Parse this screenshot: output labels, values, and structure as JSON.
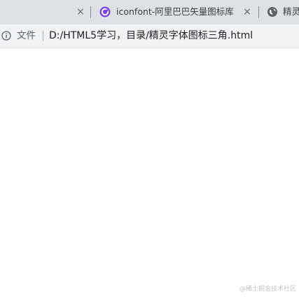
{
  "tabs": [
    {
      "title": "",
      "active": false,
      "close": "×"
    },
    {
      "title": "iconfont-阿里巴巴矢量图标库",
      "active": false,
      "icon": "iconfont-logo-icon",
      "close": "×"
    },
    {
      "title": "精灵",
      "active": false,
      "icon": "globe-icon"
    }
  ],
  "address_bar": {
    "info_icon": "info-icon",
    "file_label": "文件",
    "url": "D:/HTML5学习，目录/精灵字体图标三角.html"
  },
  "watermark": "@稀土掘金技术社区",
  "colors": {
    "tabbar_bg": "#dee1e6",
    "addressbar_bg": "#f1f3f4",
    "iconfont_logo": "#7b3ff2"
  }
}
